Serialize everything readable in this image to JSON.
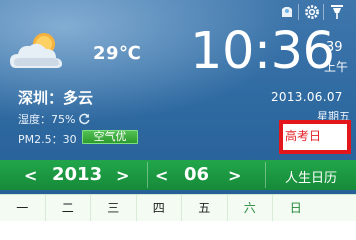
{
  "weather": {
    "icon": "partly-cloudy-icon",
    "temperature": "29℃",
    "city_condition": "深圳：多云",
    "humidity": "湿度：75%",
    "pm_label": "PM2.5：30",
    "air_quality_button": "空气优"
  },
  "clock": {
    "time": "10:36",
    "seconds": "39",
    "ampm": "上午",
    "date": "2013.06.07",
    "weekday_partial": "星期五"
  },
  "festival": {
    "text": "高考日",
    "highlight_color": "#e3161c"
  },
  "calendar": {
    "year": "2013",
    "month": "06",
    "title": "人生日历",
    "prev_arrow": "<",
    "next_arrow": ">",
    "weekdays": [
      "一",
      "二",
      "三",
      "四",
      "五",
      "六",
      "日"
    ]
  },
  "controls": {
    "icons": [
      "skin-icon",
      "gear-icon",
      "pin-icon"
    ]
  },
  "colors": {
    "background": "#2f6aa1",
    "calendar_bar": "#1a9440",
    "accent_green": "#2d9a2d"
  }
}
